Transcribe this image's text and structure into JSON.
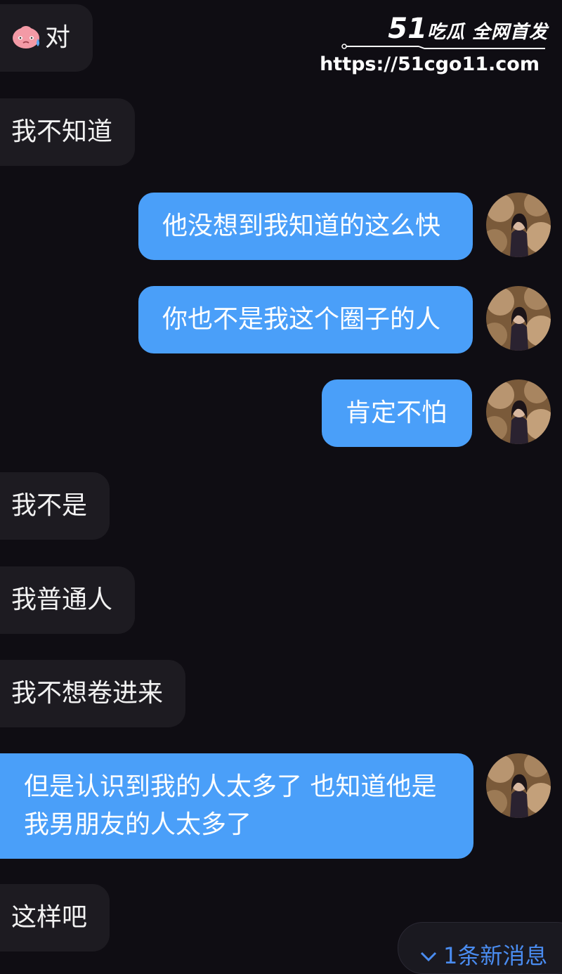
{
  "watermark": {
    "brand_number": "51",
    "brand_text": "吃瓜 全网首发",
    "url": "https://51cgo11.com"
  },
  "messages": [
    {
      "direction": "in",
      "text": "对",
      "emoji": "crying-face-sticker"
    },
    {
      "direction": "in",
      "text": "我不知道"
    },
    {
      "direction": "out",
      "text": "他没想到我知道的这么快"
    },
    {
      "direction": "out",
      "text": "你也不是我这个圈子的人"
    },
    {
      "direction": "out",
      "text": "肯定不怕"
    },
    {
      "direction": "in",
      "text": "我不是"
    },
    {
      "direction": "in",
      "text": "我普通人"
    },
    {
      "direction": "in",
      "text": "我不想卷进来"
    },
    {
      "direction": "out",
      "lines": [
        "但是认识到我的人太多了 也知道他是",
        "我男朋友的人太多了"
      ]
    },
    {
      "direction": "in",
      "text": "这样吧"
    }
  ],
  "new_message_pill": {
    "icon": "chevron-down-icon",
    "label": "1条新消息"
  },
  "colors": {
    "background": "#0f0d13",
    "incoming_bubble": "#1d1b21",
    "outgoing_bubble": "#4a9ff9",
    "new_message_text": "#4a8cf0"
  }
}
